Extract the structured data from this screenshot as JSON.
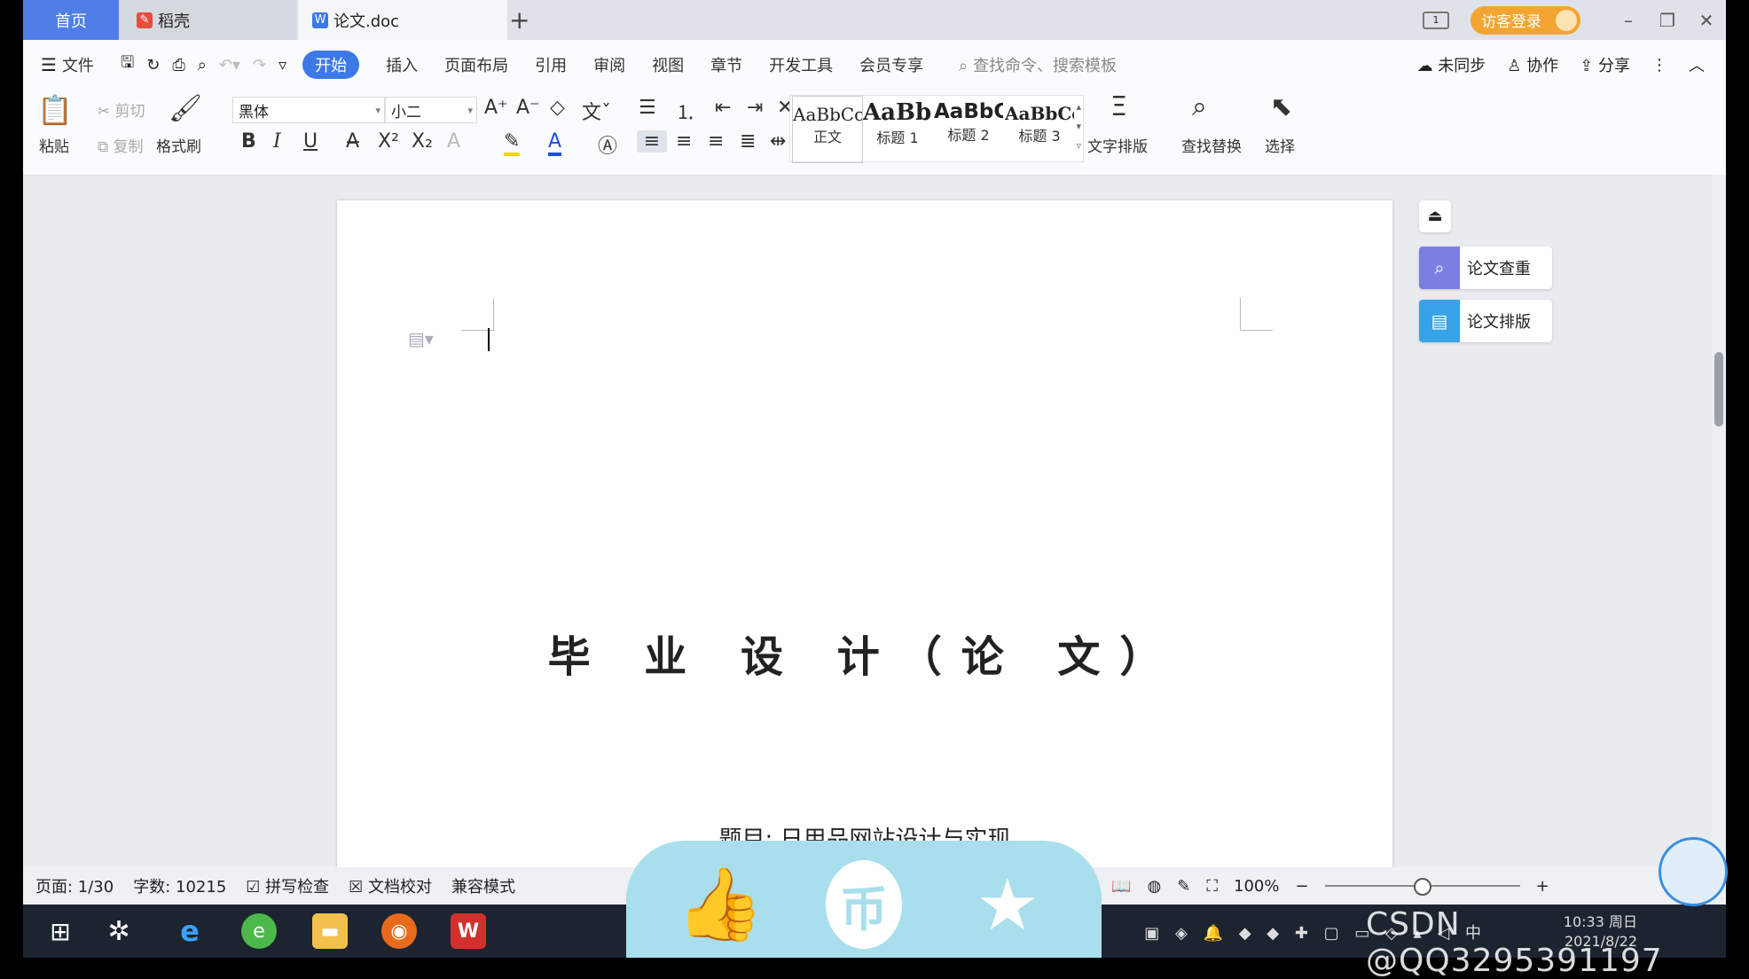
{
  "tabs": {
    "home": "首页",
    "daoke": "稻壳",
    "doc": "论文.doc"
  },
  "header": {
    "visitor_login": "访客登录"
  },
  "menu": {
    "file": "文件",
    "items": [
      "开始",
      "插入",
      "页面布局",
      "引用",
      "审阅",
      "视图",
      "章节",
      "开发工具",
      "会员专享"
    ],
    "search_placeholder": "查找命令、搜索模板",
    "unsynced": "未同步",
    "collaborate": "协作",
    "share": "分享"
  },
  "ribbon": {
    "paste": "粘贴",
    "cut": "剪切",
    "copy": "复制",
    "format_painter": "格式刷",
    "font_name": "黑体",
    "font_size": "小二",
    "styles": [
      {
        "sample": "AaBbCcI",
        "name": "正文"
      },
      {
        "sample": "AaBb(",
        "name": "标题 1"
      },
      {
        "sample": "AaBbC",
        "name": "标题 2"
      },
      {
        "sample": "AaBbCcI",
        "name": "标题 3"
      }
    ],
    "text_layout": "文字排版",
    "find_replace": "查找替换",
    "select": "选择"
  },
  "document": {
    "title": "毕 业 设 计（论 文）",
    "subject": "题目: 日用品网站设计与实现"
  },
  "side_panel": {
    "check": "论文查重",
    "layout": "论文排版"
  },
  "status": {
    "page": "页面: 1/30",
    "words": "字数: 10215",
    "spell": "拼写检查",
    "proof": "文档校对",
    "compat": "兼容模式",
    "zoom": "100%"
  },
  "tray": {
    "time": "10:33 周日",
    "date": "2021/8/22"
  },
  "watermark": "CSDN @QQ3295391197",
  "colors": {
    "accent": "#3c79e6",
    "visitor": "#f2a531",
    "overlay": "#a9dfec"
  }
}
